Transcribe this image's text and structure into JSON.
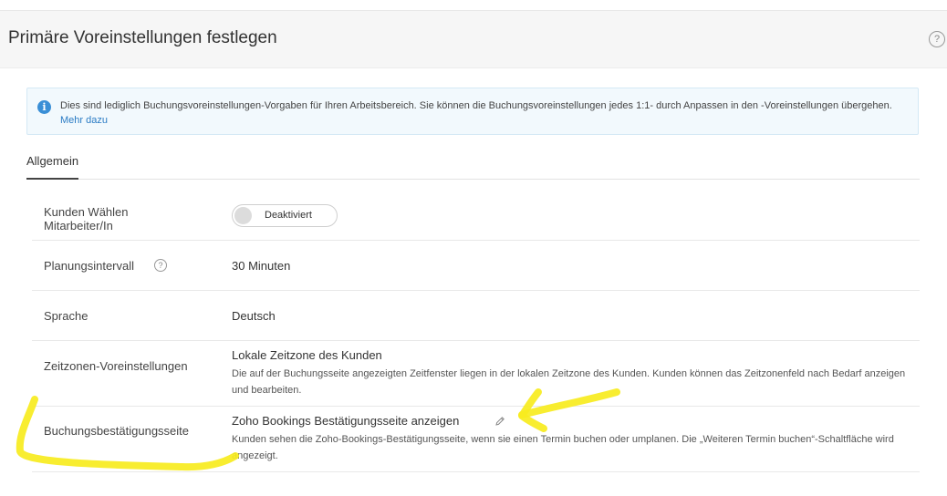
{
  "header": {
    "title": "Primäre Voreinstellungen festlegen",
    "help_icon": "?"
  },
  "info": {
    "icon": "i",
    "text": "Dies sind lediglich Buchungsvoreinstellungen-Vorgaben für Ihren Arbeitsbereich. Sie können die Buchungsvoreinstellungen jedes 1:1- durch Anpassen in den -Voreinstellungen übergehen.",
    "link": "Mehr dazu"
  },
  "tabs": [
    {
      "label": "Allgemein",
      "active": true
    }
  ],
  "rows": {
    "customers_choose_staff": {
      "label": "Kunden Wählen Mitarbeiter/In",
      "toggle_label": "Deaktiviert",
      "enabled": false
    },
    "scheduling_interval": {
      "label": "Planungsintervall",
      "help_icon": "?",
      "value": "30 Minuten"
    },
    "language": {
      "label": "Sprache",
      "value": "Deutsch"
    },
    "timezone": {
      "label": "Zeitzonen-Voreinstellungen",
      "value": "Lokale Zeitzone des Kunden",
      "desc": "Die auf der Buchungsseite angezeigten Zeitfenster liegen in der lokalen Zeitzone des Kunden. Kunden können das Zeitzonenfeld nach Bedarf anzeigen und bearbeiten."
    },
    "confirmation_page": {
      "label": "Buchungsbestätigungsseite",
      "value": "Zoho Bookings Bestätigungsseite anzeigen",
      "desc": "Kunden sehen die Zoho-Bookings-Bestätigungsseite, wenn sie einen Termin buchen oder umplanen. Die „Weiteren Termin buchen“-Schaltfläche wird angezeigt."
    }
  },
  "colors": {
    "accent_link": "#2a7bc4",
    "info_icon": "#3a8fd6",
    "annotation": "#f7ec1e"
  }
}
